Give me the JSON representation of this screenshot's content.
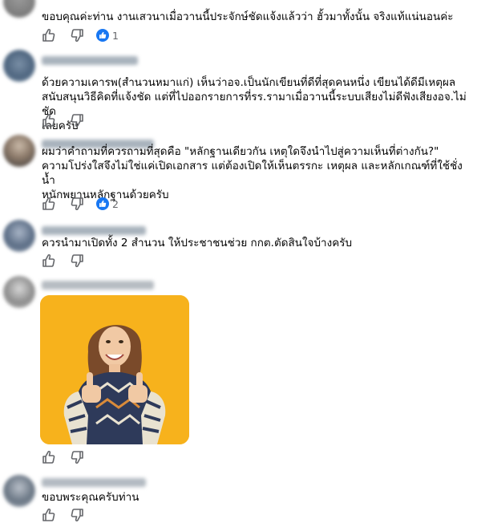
{
  "colors": {
    "text": "#050505",
    "muted": "#65676b",
    "like_blue": "#1877f2",
    "gif_bg": "#f7b21c"
  },
  "comments": [
    {
      "text": "ขอบคุณค่ะท่าน งานเสวนาเมื่อวานนี้ประจักษ์ชัดแจ้งแล้วว่า ฮั้วมาทั้งนั้น จริงแท้แน่นอนค่ะ",
      "reaction_count": "1"
    },
    {
      "text": "ด้วยความเคารพ(สำนวนหมาแก่) เห็นว่าอจ.เป็นนักเขียนที่ดีที่สุดคนหนึ่ง เขียนได้ดีมีเหตุผล\nสนับสนุนวิธีคิดที่แจ้งชัด แต่ที่ไปออกรายการที่รร.รามาเมื่อวานนี้ระบบเสียงไม่ดีฟังเสียงอจ.ไม่ชัด\nเลยครับ"
    },
    {
      "text": "ผมว่าคำถามที่ควรถามที่สุดคือ \"หลักฐานเดียวกัน เหตุใดจึงนำไปสู่ความเห็นที่ต่างกัน?\"\nความโปร่งใสจึงไม่ใช่แค่เปิดเอกสาร แต่ต้องเปิดให้เห็นตรรกะ เหตุผล และหลักเกณฑ์ที่ใช้ชั่งน้ำ\nหนักพยานหลักฐานด้วยครับ",
      "reaction_count": "2"
    },
    {
      "text": "ควรนำมาเปิดทั้ง 2 สำนวน ให้ประชาชนช่วย กกต.ตัดสินใจบ้างครับ"
    },
    {
      "gif": true
    },
    {
      "text": "ขอบพระคุณครับท่าน"
    }
  ],
  "icons": {
    "like": "thumbs-up-icon",
    "dislike": "thumbs-down-icon",
    "reaction": "like-reaction-icon"
  }
}
